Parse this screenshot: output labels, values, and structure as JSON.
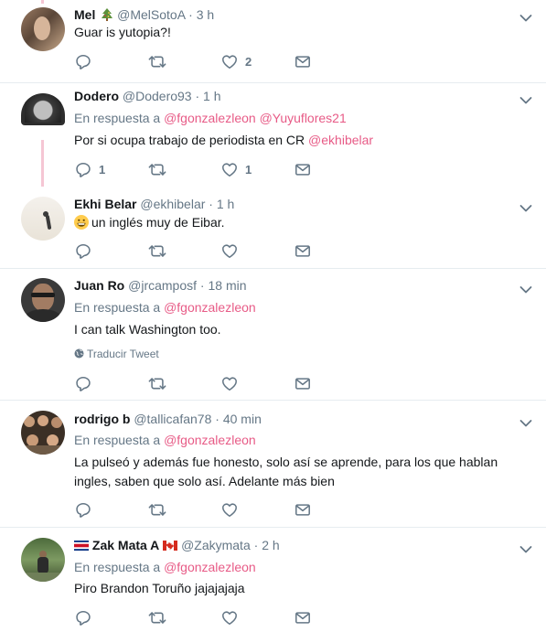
{
  "tweets": [
    {
      "name": "Mel",
      "name_emoji_icon": "christmas-tree-icon",
      "handle": "@MelSotoA",
      "dot": "·",
      "time": "3 h",
      "text": "Guar is yutopia?!",
      "likes": "2",
      "replies": "",
      "retweets": ""
    },
    {
      "name": "Dodero",
      "handle": "@Dodero93",
      "dot": "·",
      "time": "1 h",
      "reply_prefix": "En respuesta a",
      "reply_users": [
        "@fgonzalezleon",
        "@Yuyuflores21"
      ],
      "text_plain": "Por si ocupa trabajo de periodista en CR",
      "text_mention": "@ekhibelar",
      "replies": "1",
      "likes": "1"
    },
    {
      "name": "Ekhi Belar",
      "handle": "@ekhibelar",
      "dot": "·",
      "time": "1 h",
      "text": "un inglés muy de Eibar."
    },
    {
      "name": "Juan Ro",
      "handle": "@jrcamposf",
      "dot": "·",
      "time": "18 min",
      "reply_prefix": "En respuesta a",
      "reply_users": [
        "@fgonzalezleon"
      ],
      "text": "I can talk Washington too.",
      "translate_label": "Traducir Tweet"
    },
    {
      "name": "rodrigo b",
      "handle": "@tallicafan78",
      "dot": "·",
      "time": "40 min",
      "reply_prefix": "En respuesta a",
      "reply_users": [
        "@fgonzalezleon"
      ],
      "text": "La pulseó y además fue honesto, solo así se aprende, para los que hablan ingles, saben que solo así. Adelante más bien"
    },
    {
      "name": "Zak Mata A",
      "handle": "@Zakymata",
      "dot": "·",
      "time": "2 h",
      "reply_prefix": "En respuesta a",
      "reply_users": [
        "@fgonzalezleon"
      ],
      "text": "Piro Brandon Toruño jajajajaja"
    }
  ],
  "colors": {
    "link": "#e0245e",
    "muted": "#657786",
    "text": "#14171a",
    "border": "#e6ecf0",
    "thread": "#f5c6d4"
  },
  "icons": [
    "reply-icon",
    "retweet-icon",
    "like-icon",
    "direct-message-icon",
    "chevron-down-icon",
    "globe-icon",
    "costa-rica-flag-icon",
    "canada-flag-icon",
    "grinning-emoji-icon"
  ]
}
